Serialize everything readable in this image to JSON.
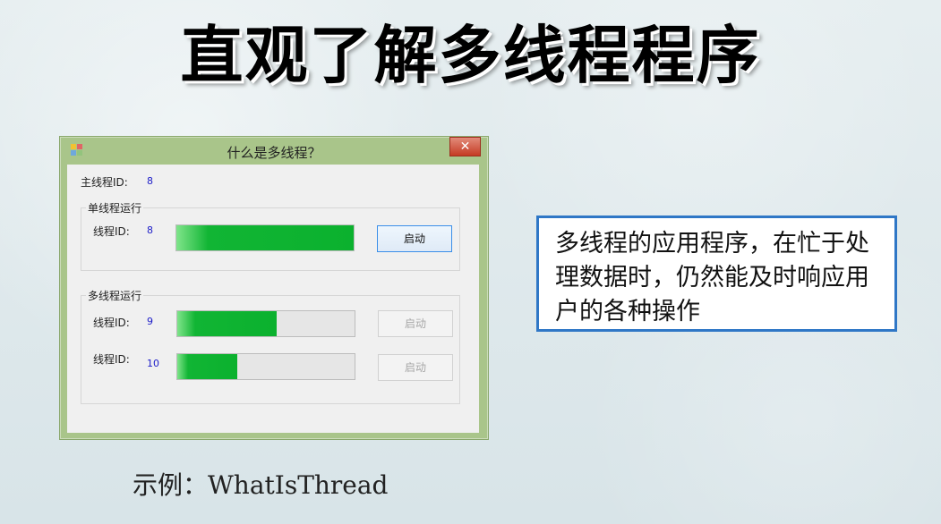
{
  "slide": {
    "title": "直观了解多线程程序",
    "callout_text": "多线程的应用程序，在忙于处理数据时，仍然能及时响应用户的各种操作",
    "caption": "示例：WhatIsThread"
  },
  "window": {
    "title": "什么是多线程？",
    "close_label": "✕",
    "main_thread_label": "主线程ID:",
    "main_thread_id": "8",
    "single_group_title": "单线程运行",
    "single_thread_label": "线程ID:",
    "single_thread_id": "8",
    "single_start_label": "启动",
    "multi_group_title": "多线程运行",
    "multi_thread1_label": "线程ID:",
    "multi_thread1_id": "9",
    "multi_thread1_start_label": "启动",
    "multi_thread2_label": "线程ID:",
    "multi_thread2_id": "10",
    "multi_thread2_start_label": "启动"
  },
  "progress": {
    "single": 1.0,
    "multi1": 0.56,
    "multi2": 0.34
  },
  "colors": {
    "window_frame": "#a9c58a",
    "callout_border": "#2f77c6",
    "accent_green": "#0bb12e",
    "close_red": "#c53b24"
  },
  "icons": {
    "app": "app-icon",
    "close": "close-icon"
  }
}
